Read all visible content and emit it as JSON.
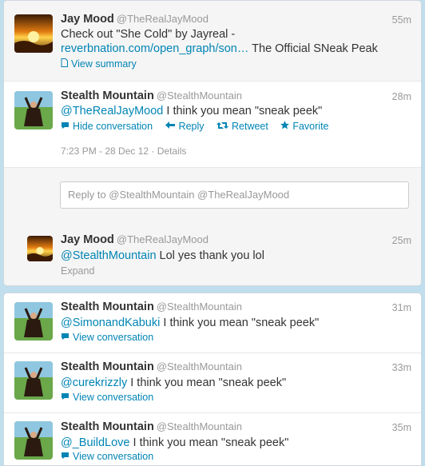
{
  "conversation": {
    "tweet1": {
      "name": "Jay Mood",
      "handle": "@TheRealJayMood",
      "time": "55m",
      "text_before": "Check out \"She Cold\" by Jayreal -",
      "link": "reverbnation.com/open_graph/son…",
      "text_after": " The Official SNeak Peak",
      "action": "View summary"
    },
    "tweet2": {
      "name": "Stealth Mountain",
      "handle": "@StealthMountain",
      "time": "28m",
      "mention": "@TheRealJayMood",
      "text": " I think you mean \"sneak peek\"",
      "actions": {
        "hide": "Hide conversation",
        "reply": "Reply",
        "retweet": "Retweet",
        "favorite": "Favorite"
      },
      "timestamp": "7:23 PM - 28 Dec 12",
      "details": "Details"
    },
    "reply_placeholder": "Reply to @StealthMountain @TheRealJayMood",
    "tweet3": {
      "name": "Jay Mood",
      "handle": "@TheRealJayMood",
      "time": "25m",
      "mention": "@StealthMountain",
      "text": " Lol yes thank you lol",
      "action": "Expand"
    }
  },
  "list": [
    {
      "name": "Stealth Mountain",
      "handle": "@StealthMountain",
      "time": "31m",
      "mention": "@SimonandKabuki",
      "text": " I think you mean \"sneak peek\"",
      "action": "View conversation"
    },
    {
      "name": "Stealth Mountain",
      "handle": "@StealthMountain",
      "time": "33m",
      "mention": "@curekrizzly",
      "text": " I think you mean \"sneak peek\"",
      "action": "View conversation"
    },
    {
      "name": "Stealth Mountain",
      "handle": "@StealthMountain",
      "time": "35m",
      "mention": "@_BuildLove",
      "text": " I think you mean \"sneak peek\"",
      "action": "View conversation"
    }
  ],
  "colors": {
    "link": "#0084b4",
    "page_background": "#c0deed",
    "muted": "#999999"
  },
  "icons": {
    "summary": "document-icon",
    "hide": "speech-bubble-icon",
    "reply": "reply-arrow-icon",
    "retweet": "retweet-icon",
    "favorite": "star-icon",
    "view_conversation": "speech-bubble-icon"
  }
}
